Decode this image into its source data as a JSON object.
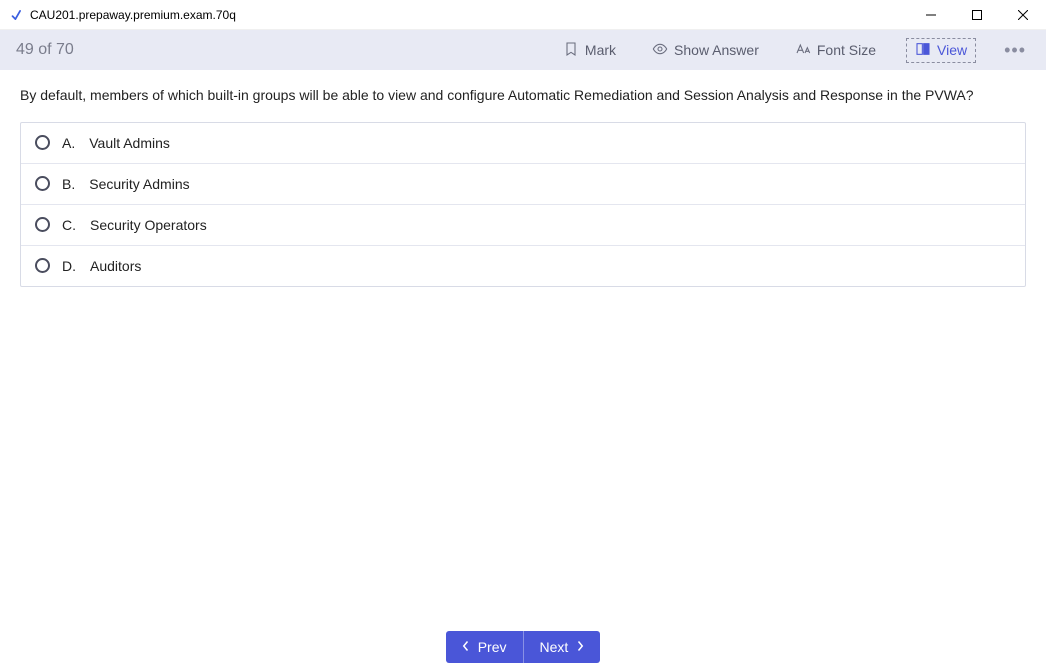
{
  "window": {
    "title": "CAU201.prepaway.premium.exam.70q"
  },
  "toolbar": {
    "counter": "49 of 70",
    "mark_label": "Mark",
    "show_answer_label": "Show Answer",
    "font_size_label": "Font Size",
    "view_label": "View"
  },
  "question": {
    "text": "By default, members of which built-in groups will be able to view and configure Automatic Remediation and Session Analysis and Response in the PVWA?",
    "options": [
      {
        "letter": "A.",
        "text": "Vault Admins"
      },
      {
        "letter": "B.",
        "text": "Security Admins"
      },
      {
        "letter": "C.",
        "text": "Security Operators"
      },
      {
        "letter": "D.",
        "text": "Auditors"
      }
    ]
  },
  "footer": {
    "prev_label": "Prev",
    "next_label": "Next"
  }
}
